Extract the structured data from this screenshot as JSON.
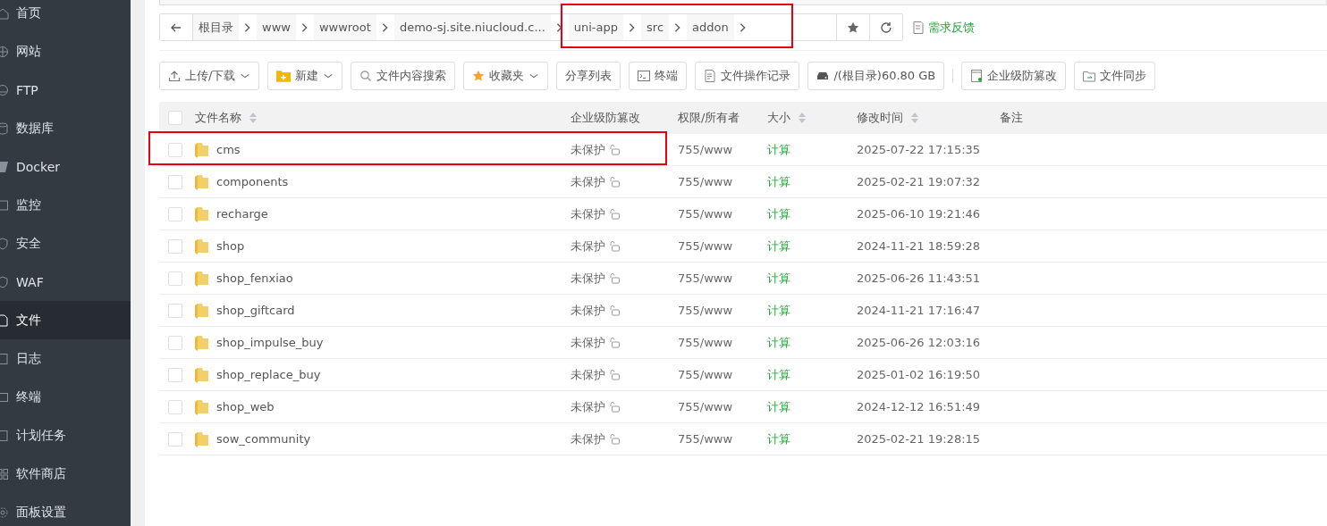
{
  "sidebar": {
    "items": [
      {
        "label": "首页",
        "selected": false
      },
      {
        "label": "网站",
        "selected": false
      },
      {
        "label": "FTP",
        "selected": false
      },
      {
        "label": "数据库",
        "selected": false
      },
      {
        "label": "Docker",
        "selected": false
      },
      {
        "label": "监控",
        "selected": false
      },
      {
        "label": "安全",
        "selected": false
      },
      {
        "label": "WAF",
        "selected": false
      },
      {
        "label": "文件",
        "selected": true
      },
      {
        "label": "日志",
        "selected": false
      },
      {
        "label": "终端",
        "selected": false
      },
      {
        "label": "计划任务",
        "selected": false
      },
      {
        "label": "软件商店",
        "selected": false
      },
      {
        "label": "面板设置",
        "selected": false
      }
    ]
  },
  "breadcrumb": {
    "segments": [
      {
        "label": "根目录",
        "highlighted": false
      },
      {
        "label": "www",
        "highlighted": false
      },
      {
        "label": "wwwroot",
        "highlighted": false
      },
      {
        "label": "demo-sj.site.niucloud.c...",
        "highlighted": false
      },
      {
        "label": "uni-app",
        "highlighted": true
      },
      {
        "label": "src",
        "highlighted": true
      },
      {
        "label": "addon",
        "highlighted": true
      }
    ],
    "feedback": "需求反馈"
  },
  "toolbar": [
    {
      "label": "上传/下载",
      "dropdown": true
    },
    {
      "label": "新建",
      "dropdown": true
    },
    {
      "label": "文件内容搜索",
      "dropdown": false
    },
    {
      "label": "收藏夹",
      "dropdown": true
    },
    {
      "label": "分享列表",
      "dropdown": false
    },
    {
      "label": "终端",
      "dropdown": false
    },
    {
      "label": "文件操作记录",
      "dropdown": false
    },
    {
      "label": "/(根目录)60.80 GB",
      "dropdown": false
    },
    {
      "label": "企业级防篡改",
      "dropdown": false
    },
    {
      "label": "文件同步",
      "dropdown": false
    }
  ],
  "table": {
    "all_checked": false,
    "columns": [
      {
        "label": "文件名称",
        "sortable": true
      },
      {
        "label": "企业级防篡改",
        "sortable": false
      },
      {
        "label": "权限/所有者",
        "sortable": false
      },
      {
        "label": "大小",
        "sortable": true
      },
      {
        "label": "修改时间",
        "sortable": true
      },
      {
        "label": "备注",
        "sortable": false
      }
    ],
    "rows": [
      {
        "name": "cms",
        "protection": "未保护",
        "perms": "755/www",
        "size": "计算",
        "modified": "2025-07-22 17:15:35",
        "checked": false,
        "highlighted": true
      },
      {
        "name": "components",
        "protection": "未保护",
        "perms": "755/www",
        "size": "计算",
        "modified": "2025-02-21 19:07:32",
        "checked": false,
        "highlighted": false
      },
      {
        "name": "recharge",
        "protection": "未保护",
        "perms": "755/www",
        "size": "计算",
        "modified": "2025-06-10 19:21:46",
        "checked": false,
        "highlighted": false
      },
      {
        "name": "shop",
        "protection": "未保护",
        "perms": "755/www",
        "size": "计算",
        "modified": "2024-11-21 18:59:28",
        "checked": false,
        "highlighted": false
      },
      {
        "name": "shop_fenxiao",
        "protection": "未保护",
        "perms": "755/www",
        "size": "计算",
        "modified": "2025-06-26 11:43:51",
        "checked": false,
        "highlighted": false
      },
      {
        "name": "shop_giftcard",
        "protection": "未保护",
        "perms": "755/www",
        "size": "计算",
        "modified": "2024-11-21 17:16:47",
        "checked": false,
        "highlighted": false
      },
      {
        "name": "shop_impulse_buy",
        "protection": "未保护",
        "perms": "755/www",
        "size": "计算",
        "modified": "2025-06-26 12:03:16",
        "checked": false,
        "highlighted": false
      },
      {
        "name": "shop_replace_buy",
        "protection": "未保护",
        "perms": "755/www",
        "size": "计算",
        "modified": "2025-01-02 16:19:50",
        "checked": false,
        "highlighted": false
      },
      {
        "name": "shop_web",
        "protection": "未保护",
        "perms": "755/www",
        "size": "计算",
        "modified": "2024-12-12 16:51:49",
        "checked": false,
        "highlighted": false
      },
      {
        "name": "sow_community",
        "protection": "未保护",
        "perms": "755/www",
        "size": "计算",
        "modified": "2025-02-21 19:28:15",
        "checked": false,
        "highlighted": false
      }
    ]
  }
}
